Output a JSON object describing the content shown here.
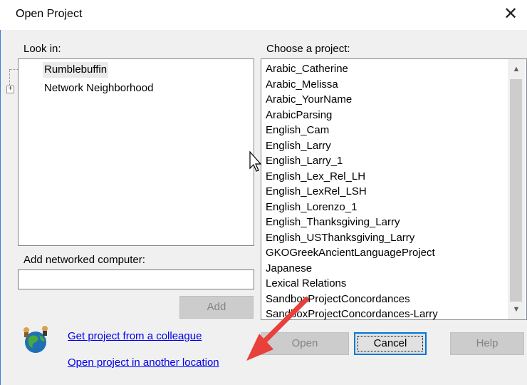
{
  "window": {
    "title": "Open Project",
    "close_glyph": "✕"
  },
  "look_in": {
    "label": "Look in:",
    "items": [
      {
        "label": "Rumblebuffin"
      },
      {
        "label": "Network Neighborhood"
      }
    ],
    "expander_glyph": "+"
  },
  "add_computer": {
    "label": "Add networked computer:",
    "value": "",
    "button": "Add"
  },
  "projects": {
    "label": "Choose a project:",
    "items": [
      "Arabic_Catherine",
      "Arabic_Melissa",
      "Arabic_YourName",
      "ArabicParsing",
      "English_Cam",
      "English_Larry",
      "English_Larry_1",
      "English_Lex_Rel_LH",
      "English_LexRel_LSH",
      "English_Lorenzo_1",
      "English_Thanksgiving_Larry",
      "English_USThanksgiving_Larry",
      "GKOGreekAncientLanguageProject",
      "Japanese",
      "Lexical Relations",
      "SandboxProjectConcordances",
      "SandboxProjectConcordances-Larry"
    ],
    "scroll_up": "▲",
    "scroll_down": "▼"
  },
  "links": {
    "colleague": "Get project from a colleague",
    "other_location": "Open project in another location"
  },
  "buttons": {
    "open": "Open",
    "cancel": "Cancel",
    "help": "Help"
  },
  "colors": {
    "annotation_arrow": "#e8403a",
    "focus_border": "#0078d7"
  }
}
